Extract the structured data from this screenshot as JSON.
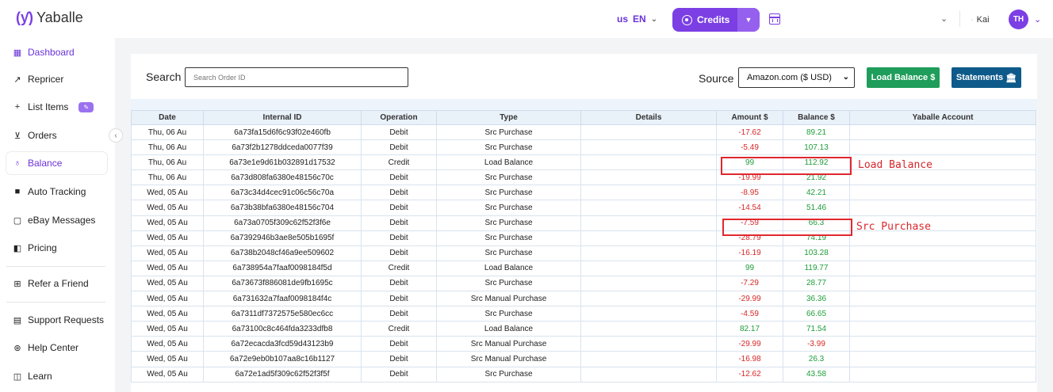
{
  "header": {
    "logo_text": "Yaballe",
    "region": "us",
    "language": "EN",
    "credits_label": "Credits",
    "user_name": "Kai",
    "avatar_initials": "TH"
  },
  "sidebar": {
    "items": [
      {
        "label": "Dashboard",
        "icon": "grid-icon"
      },
      {
        "label": "Repricer",
        "icon": "trend-icon"
      },
      {
        "label": "List Items",
        "icon": "plus-icon",
        "badge": true
      },
      {
        "label": "Orders",
        "icon": "cart-icon"
      },
      {
        "label": "Balance",
        "icon": "money-bag-icon"
      },
      {
        "label": "Auto Tracking",
        "icon": "truck-icon"
      },
      {
        "label": "eBay Messages",
        "icon": "chat-icon"
      },
      {
        "label": "Pricing",
        "icon": "tag-icon"
      },
      {
        "label": "Refer a Friend",
        "icon": "gift-icon"
      },
      {
        "label": "Support Requests",
        "icon": "document-icon"
      },
      {
        "label": "Help Center",
        "icon": "lifebuoy-icon"
      },
      {
        "label": "Learn",
        "icon": "book-icon"
      }
    ]
  },
  "toolbar": {
    "search_label": "Search",
    "search_placeholder": "Search Order ID",
    "source_label": "Source",
    "source_value": "Amazon.com ($ USD)",
    "load_balance_label": "Load Balance $",
    "statements_label": "Statements"
  },
  "table": {
    "columns": [
      "Date",
      "Internal ID",
      "Operation",
      "Type",
      "Details",
      "Amount $",
      "Balance $",
      "Yaballe Account"
    ],
    "rows": [
      {
        "date": "Thu, 06 Au",
        "id": "6a73fa15d6f6c93f02e460fb",
        "operation": "Debit",
        "type": "Src Purchase",
        "amount": "-17.62",
        "balance": "89.21"
      },
      {
        "date": "Thu, 06 Au",
        "id": "6a73f2b1278ddceda0077f39",
        "operation": "Debit",
        "type": "Src Purchase",
        "amount": "-5.49",
        "balance": "107.13"
      },
      {
        "date": "Thu, 06 Au",
        "id": "6a73e1e9d61b032891d17532",
        "operation": "Credit",
        "type": "Load Balance",
        "amount": "99",
        "balance": "112.92"
      },
      {
        "date": "Thu, 06 Au",
        "id": "6a73d808fa6380e48156c70c",
        "operation": "Debit",
        "type": "Src Purchase",
        "amount": "-19.99",
        "balance": "21.92"
      },
      {
        "date": "Wed, 05 Au",
        "id": "6a73c34d4cec91c06c56c70a",
        "operation": "Debit",
        "type": "Src Purchase",
        "amount": "-8.95",
        "balance": "42.21"
      },
      {
        "date": "Wed, 05 Au",
        "id": "6a73b38bfa6380e48156c704",
        "operation": "Debit",
        "type": "Src Purchase",
        "amount": "-14.54",
        "balance": "51.46"
      },
      {
        "date": "Wed, 05 Au",
        "id": "6a73a0705f309c62f52f3f6e",
        "operation": "Debit",
        "type": "Src Purchase",
        "amount": "-7.59",
        "balance": "66.3"
      },
      {
        "date": "Wed, 05 Au",
        "id": "6a7392946b3ae8e505b1695f",
        "operation": "Debit",
        "type": "Src Purchase",
        "amount": "-28.79",
        "balance": "74.19"
      },
      {
        "date": "Wed, 05 Au",
        "id": "6a738b2048cf46a9ee509602",
        "operation": "Debit",
        "type": "Src Purchase",
        "amount": "-16.19",
        "balance": "103.28"
      },
      {
        "date": "Wed, 05 Au",
        "id": "6a738954a7faaf0098184f5d",
        "operation": "Credit",
        "type": "Load Balance",
        "amount": "99",
        "balance": "119.77"
      },
      {
        "date": "Wed, 05 Au",
        "id": "6a73673f886081de9fb1695c",
        "operation": "Debit",
        "type": "Src Purchase",
        "amount": "-7.29",
        "balance": "28.77"
      },
      {
        "date": "Wed, 05 Au",
        "id": "6a731632a7faaf0098184f4c",
        "operation": "Debit",
        "type": "Src Manual Purchase",
        "amount": "-29.99",
        "balance": "36.36"
      },
      {
        "date": "Wed, 05 Au",
        "id": "6a7311df7372575e580ec6cc",
        "operation": "Debit",
        "type": "Src Purchase",
        "amount": "-4.59",
        "balance": "66.65"
      },
      {
        "date": "Wed, 05 Au",
        "id": "6a73100c8c464fda3233dfb8",
        "operation": "Credit",
        "type": "Load Balance",
        "amount": "82.17",
        "balance": "71.54"
      },
      {
        "date": "Wed, 05 Au",
        "id": "6a72ecacda3fcd59d43123b9",
        "operation": "Debit",
        "type": "Src Manual Purchase",
        "amount": "-29.99",
        "balance": "-3.99"
      },
      {
        "date": "Wed, 05 Au",
        "id": "6a72e9eb0b107aa8c16b1127",
        "operation": "Debit",
        "type": "Src Manual Purchase",
        "amount": "-16.98",
        "balance": "26.3"
      },
      {
        "date": "Wed, 05 Au",
        "id": "6a72e1ad5f309c62f52f3f5f",
        "operation": "Debit",
        "type": "Src Purchase",
        "amount": "-12.62",
        "balance": "43.58"
      }
    ]
  },
  "annotations": [
    {
      "text": "Load Balance"
    },
    {
      "text": "Src Purchase"
    }
  ],
  "colors": {
    "accent": "#7b3fe4",
    "negative": "#d62828",
    "positive": "#1f9d3a",
    "load_button": "#1f9d5a",
    "statements_button": "#0e5a8a",
    "annotation": "#e0282e"
  }
}
